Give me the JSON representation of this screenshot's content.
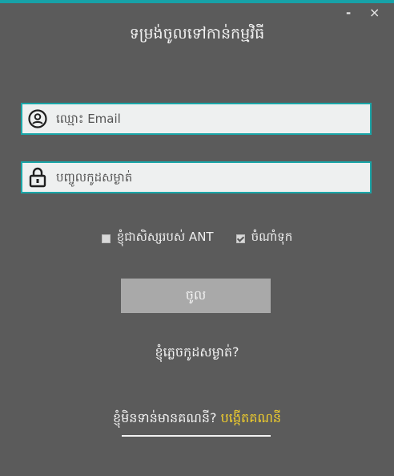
{
  "window": {
    "title": "ទម្រង់ចូលទៅកាន់កម្មវិធី",
    "minimize_glyph": "-",
    "close_glyph": "×",
    "accent_color": "#17a2a8"
  },
  "form": {
    "username_placeholder": "ឈ្មោះ Email",
    "password_placeholder": "បញ្ចូលកូដសម្ងាត់",
    "username_icon": "user-circle-icon",
    "password_icon": "lock-icon"
  },
  "options": {
    "member_label": "ខ្ញុំជាសិស្សរបស់ ANT",
    "member_checked": false,
    "remember_label": "ចំណាំទុក",
    "remember_checked": true
  },
  "actions": {
    "login_label": "ចូល",
    "forgot_label": "ខ្ញុំភ្លេចកូដសម្ងាត់?",
    "no_account_label": "ខ្ញុំមិនទាន់មានគណនី?",
    "signup_label": "បង្កើតគណនី",
    "signup_color": "#f2cf2c"
  }
}
